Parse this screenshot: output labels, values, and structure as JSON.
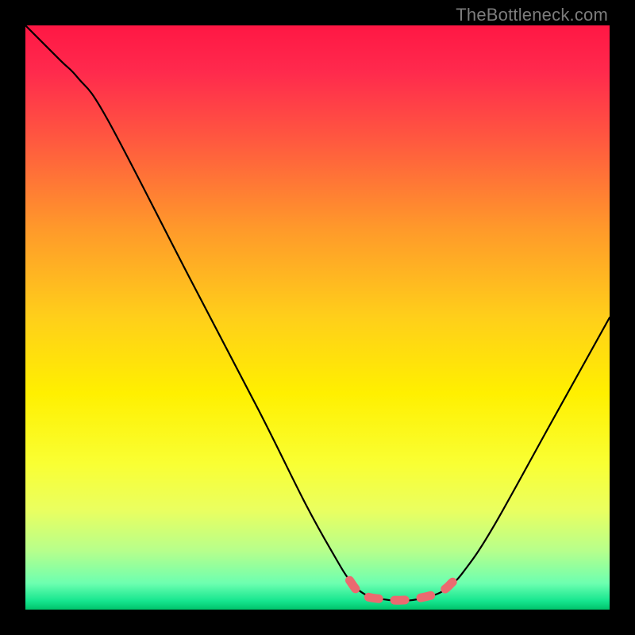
{
  "watermark": "TheBottleneck.com",
  "chart_data": {
    "type": "line",
    "title": "",
    "xlabel": "",
    "ylabel": "",
    "xlim": [
      0,
      100
    ],
    "ylim": [
      0,
      100
    ],
    "background_gradient": {
      "stops": [
        {
          "offset": 0.0,
          "color": "#ff1744"
        },
        {
          "offset": 0.08,
          "color": "#ff2a4d"
        },
        {
          "offset": 0.2,
          "color": "#ff5a3f"
        },
        {
          "offset": 0.35,
          "color": "#ff9a2a"
        },
        {
          "offset": 0.5,
          "color": "#ffcf1a"
        },
        {
          "offset": 0.63,
          "color": "#fff000"
        },
        {
          "offset": 0.75,
          "color": "#f9ff33"
        },
        {
          "offset": 0.83,
          "color": "#eaff60"
        },
        {
          "offset": 0.9,
          "color": "#b6ff8c"
        },
        {
          "offset": 0.955,
          "color": "#6dffb0"
        },
        {
          "offset": 0.985,
          "color": "#16e68f"
        },
        {
          "offset": 1.0,
          "color": "#00c36b"
        }
      ]
    },
    "series": [
      {
        "name": "bottleneck-curve",
        "color": "#000000",
        "points": [
          {
            "x": 0,
            "y": 100
          },
          {
            "x": 6,
            "y": 94
          },
          {
            "x": 9,
            "y": 91
          },
          {
            "x": 14,
            "y": 84
          },
          {
            "x": 28,
            "y": 57
          },
          {
            "x": 40,
            "y": 34
          },
          {
            "x": 48,
            "y": 18
          },
          {
            "x": 53,
            "y": 9
          },
          {
            "x": 55.5,
            "y": 5
          },
          {
            "x": 57.5,
            "y": 3
          },
          {
            "x": 60,
            "y": 2
          },
          {
            "x": 65,
            "y": 1.5
          },
          {
            "x": 70,
            "y": 2.5
          },
          {
            "x": 72.5,
            "y": 4
          },
          {
            "x": 75,
            "y": 6.5
          },
          {
            "x": 80,
            "y": 14
          },
          {
            "x": 90,
            "y": 32
          },
          {
            "x": 100,
            "y": 50
          }
        ]
      },
      {
        "name": "dashed-marker",
        "color": "#eb6a70",
        "style": "dashed",
        "points": [
          {
            "x": 55.5,
            "y": 5
          },
          {
            "x": 57,
            "y": 3
          },
          {
            "x": 58.5,
            "y": 2.2
          },
          {
            "x": 61,
            "y": 1.8
          },
          {
            "x": 64,
            "y": 1.6
          },
          {
            "x": 67,
            "y": 1.9
          },
          {
            "x": 70,
            "y": 2.6
          },
          {
            "x": 71.8,
            "y": 3.5
          },
          {
            "x": 73,
            "y": 4.6
          },
          {
            "x": 74.3,
            "y": 5.9
          }
        ]
      }
    ]
  }
}
